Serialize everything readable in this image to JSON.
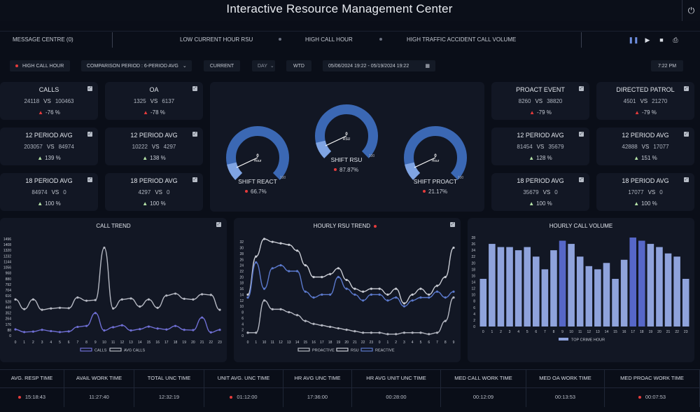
{
  "header": {
    "title": "Interactive Resource Management Center"
  },
  "messages": {
    "centre_label": "MESSAGE CENTRE (0)",
    "ticker": [
      "LOW CURRENT HOUR RSU",
      "HIGH CALL HOUR",
      "HIGH TRAFFIC ACCIDENT CALL VOLUME"
    ]
  },
  "filters": {
    "alert": "HIGH CALL HOUR",
    "comparison": "COMPARISON PERIOD :  6-PERIOD AVG",
    "current": "CURRENT",
    "granularity": "DAY",
    "wtd": "WTD",
    "date_range": "05/06/2024 19:22 - 05/19/2024 19:22",
    "time": "7:22 PM"
  },
  "kpis_left": [
    {
      "title": "CALLS",
      "a": "24118",
      "b": "100463",
      "pct": "-76 %",
      "trend": "down"
    },
    {
      "title": "OA",
      "a": "1325",
      "b": "6137",
      "pct": "-78 %",
      "trend": "down"
    },
    {
      "title": "12 PERIOD AVG",
      "a": "203057",
      "b": "84974",
      "pct": "139 %",
      "trend": "up"
    },
    {
      "title": "12 PERIOD AVG",
      "a": "10222",
      "b": "4297",
      "pct": "138 %",
      "trend": "up"
    },
    {
      "title": "18 PERIOD AVG",
      "a": "84974",
      "b": "0",
      "pct": "100 %",
      "trend": "up"
    },
    {
      "title": "18 PERIOD AVG",
      "a": "4297",
      "b": "0",
      "pct": "100 %",
      "trend": "up"
    }
  ],
  "kpis_right": [
    {
      "title": "PROACT EVENT",
      "a": "8260",
      "b": "38820",
      "pct": "-79 %",
      "trend": "down"
    },
    {
      "title": "DIRECTED PATROL",
      "a": "4501",
      "b": "21270",
      "pct": "-79 %",
      "trend": "down"
    },
    {
      "title": "12 PERIOD AVG",
      "a": "81454",
      "b": "35679",
      "pct": "128 %",
      "trend": "up"
    },
    {
      "title": "12 PERIOD AVG",
      "a": "42888",
      "b": "17077",
      "pct": "151 %",
      "trend": "up"
    },
    {
      "title": "18 PERIOD AVG",
      "a": "35679",
      "b": "0",
      "pct": "100 %",
      "trend": "up"
    },
    {
      "title": "18 PERIOD AVG",
      "a": "17077",
      "b": "0",
      "pct": "100 %",
      "trend": "up"
    }
  ],
  "vs_label": "VS",
  "gauges": [
    {
      "name": "SHIFT REACT",
      "pct": "66.7%",
      "level": 0.667,
      "needle": "0",
      "unit": "Hour",
      "max": "100"
    },
    {
      "name": "SHIFT RSU",
      "pct": "87.87%",
      "level": 0.8787,
      "needle": "0",
      "unit": "RSU",
      "max": "100"
    },
    {
      "name": "SHIFT PROACT",
      "pct": "21.17%",
      "level": 0.2117,
      "needle": "0",
      "unit": "Hour",
      "max": "100"
    }
  ],
  "colors": {
    "accent": "#3b68b4",
    "accent_light": "#7fa4e3",
    "alert_red": "#e53b3b",
    "up_green": "#b6e3a8",
    "bar": "#8fa3dc",
    "bar_dark": "#5667c8"
  },
  "chart_data": [
    {
      "type": "line",
      "title": "CALL TREND",
      "x": [
        "0",
        "1",
        "2",
        "3",
        "4",
        "5",
        "6",
        "7",
        "8",
        "9",
        "10",
        "11",
        "12",
        "13",
        "14",
        "15",
        "16",
        "17",
        "18",
        "19",
        "20",
        "21",
        "22",
        "23"
      ],
      "ylim": [
        0,
        1496
      ],
      "yticks": [
        "0",
        "88",
        "176",
        "264",
        "352",
        "440",
        "528",
        "616",
        "704",
        "792",
        "880",
        "968",
        "1056",
        "1144",
        "1232",
        "1320",
        "1408",
        "1496"
      ],
      "series": [
        {
          "name": "CALLS",
          "color": "#6f6fd4",
          "values": [
            96,
            55,
            62,
            90,
            70,
            55,
            65,
            135,
            150,
            350,
            80,
            130,
            160,
            80,
            100,
            140,
            110,
            95,
            150,
            90,
            85,
            280,
            50,
            90
          ]
        },
        {
          "name": "AVG CALLS",
          "color": "#b5b8c2",
          "values": [
            560,
            410,
            560,
            400,
            420,
            430,
            425,
            590,
            540,
            550,
            1360,
            420,
            560,
            575,
            450,
            560,
            430,
            620,
            650,
            570,
            560,
            640,
            630,
            400
          ]
        }
      ]
    },
    {
      "type": "line",
      "title": "HOURLY RSU TREND",
      "x": [
        "0",
        "1",
        "10",
        "11",
        "12",
        "13",
        "14",
        "15",
        "16",
        "17",
        "18",
        "19",
        "20",
        "21",
        "22",
        "23",
        "0",
        "1",
        "2",
        "3",
        "4",
        "5",
        "6",
        "7",
        "8",
        "9"
      ],
      "ylim": [
        0,
        33
      ],
      "yticks": [
        "0",
        "2",
        "4",
        "6",
        "8",
        "10",
        "12",
        "14",
        "16",
        "18",
        "20",
        "22",
        "24",
        "26",
        "28",
        "30",
        "32"
      ],
      "series": [
        {
          "name": "PROACTIVE",
          "color": "#b5b8c2",
          "values": [
            1,
            1,
            12,
            9,
            9,
            8,
            7,
            5,
            4,
            3.5,
            3,
            2.5,
            2,
            1.5,
            1,
            1,
            1,
            0.5,
            0.5,
            1,
            1,
            1,
            0.5,
            1,
            5,
            13
          ]
        },
        {
          "name": "RSU",
          "color": "#c9ccd4",
          "values": [
            14,
            27,
            33,
            32,
            31.5,
            31,
            29,
            24,
            20,
            20,
            21,
            23,
            19,
            16,
            15,
            16,
            16,
            14,
            16,
            11,
            14,
            16,
            14,
            17,
            20,
            30
          ]
        },
        {
          "name": "REACTIVE",
          "color": "#5b79cc",
          "values": [
            13,
            25,
            16,
            23,
            24,
            22,
            22,
            15,
            13,
            14,
            14,
            20,
            16,
            14,
            12,
            14,
            14,
            12,
            13,
            10,
            12,
            13,
            13,
            15,
            13,
            15
          ]
        }
      ]
    },
    {
      "type": "bar",
      "title": "HOURLY CALL VOLUME",
      "categories": [
        "0",
        "1",
        "2",
        "3",
        "4",
        "5",
        "6",
        "7",
        "8",
        "9",
        "10",
        "11",
        "12",
        "13",
        "14",
        "15",
        "16",
        "17",
        "18",
        "19",
        "20",
        "21",
        "22",
        "23"
      ],
      "values": [
        15,
        26,
        25,
        25,
        24,
        25,
        22,
        18,
        24,
        27,
        26,
        22,
        19,
        18,
        20,
        15,
        21,
        28,
        27,
        26,
        25,
        23,
        22,
        15
      ],
      "highlight": [
        "9",
        "17",
        "18"
      ],
      "ylim": [
        0,
        28
      ],
      "yticks": [
        "0",
        "2",
        "4",
        "6",
        "8",
        "10",
        "12",
        "14",
        "16",
        "18",
        "20",
        "22",
        "24",
        "26",
        "28"
      ],
      "series": [
        {
          "name": "TOP CRIME HOUR"
        }
      ]
    }
  ],
  "footer": [
    {
      "label": "AVG. RESP TIME",
      "value": "15:18:43",
      "alert": true
    },
    {
      "label": "AVAIL WORK TIME",
      "value": "11:27:40",
      "alert": false
    },
    {
      "label": "TOTAL UNC TIME",
      "value": "12:32:19",
      "alert": false
    },
    {
      "label": "UNIT AVG. UNC TIME",
      "value": "01:12:00",
      "alert": true
    },
    {
      "label": "HR AVG UNC TIME",
      "value": "17:36:00",
      "alert": false
    },
    {
      "label": "HR AVG UNIT UNC TIME",
      "value": "00:28:00",
      "alert": false
    },
    {
      "label": "MED CALL WORK TIME",
      "value": "00:12:09",
      "alert": false
    },
    {
      "label": "MED OA WORK TIME",
      "value": "00:13:53",
      "alert": false
    },
    {
      "label": "MED PROAC WORK TIME",
      "value": "00:07:53",
      "alert": true
    }
  ]
}
